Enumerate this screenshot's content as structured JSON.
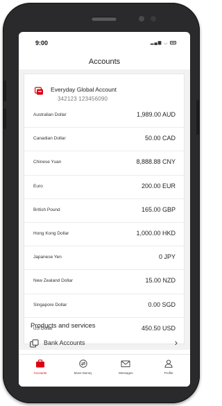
{
  "status_bar": {
    "time": "9:00"
  },
  "header": {
    "title": "Accounts"
  },
  "account": {
    "name": "Everyday Global Account",
    "number": "342123 123456090",
    "logo_icon": "bank-logo-icon",
    "brand_color": "#db0011",
    "balances": [
      {
        "currency": "Australian Dollar",
        "amount": "1,989.00 AUD"
      },
      {
        "currency": "Canadian Dollar",
        "amount": "50.00 CAD"
      },
      {
        "currency": "Chinese Yuan",
        "amount": "8,888.88 CNY"
      },
      {
        "currency": "Euro",
        "amount": "200.00 EUR"
      },
      {
        "currency": "British Pound",
        "amount": "165.00 GBP"
      },
      {
        "currency": "Hong Kong Dollar",
        "amount": "1,000.00 HKD"
      },
      {
        "currency": "Japanese Yen",
        "amount": "0 JPY"
      },
      {
        "currency": "New Zealand Dollar",
        "amount": "15.00 NZD"
      },
      {
        "currency": "Singapore Dollar",
        "amount": "0.00 SGD"
      },
      {
        "currency": "US Dollar",
        "amount": "450.50 USD"
      }
    ]
  },
  "products": {
    "title": "Products and services",
    "items": [
      {
        "label": "Bank Accounts",
        "icon": "bank-accounts-icon"
      }
    ]
  },
  "tabbar": {
    "tabs": [
      {
        "label": "Accounts",
        "icon": "briefcase-icon",
        "active": true
      },
      {
        "label": "Move Money",
        "icon": "move-money-icon",
        "active": false
      },
      {
        "label": "Messages",
        "icon": "envelope-icon",
        "active": false
      },
      {
        "label": "Profile",
        "icon": "profile-icon",
        "active": false
      }
    ]
  }
}
